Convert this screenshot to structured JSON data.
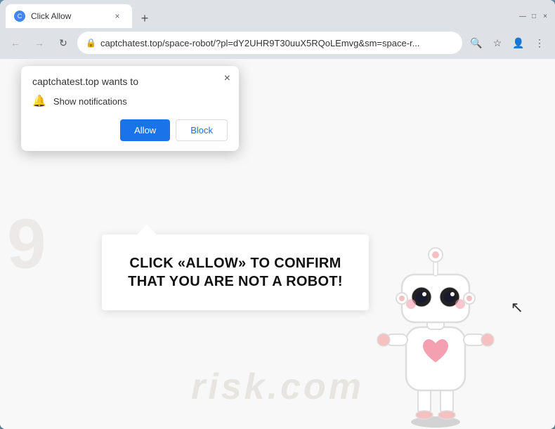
{
  "browser": {
    "tab_title": "Click Allow",
    "tab_favicon": "🔵",
    "address": "captchatest.top/space-robot/?pl=dY2UHR9T30uuX5RQoLEmvg&sm=space-r...",
    "new_tab_label": "+",
    "close_label": "×",
    "minimize_label": "—",
    "maximize_label": "□",
    "window_close_label": "×"
  },
  "nav": {
    "back_label": "←",
    "forward_label": "→",
    "refresh_label": "↻",
    "search_icon": "🔍",
    "star_icon": "☆",
    "profile_icon": "👤",
    "menu_icon": "⋮"
  },
  "popup": {
    "title": "captchatest.top wants to",
    "close_label": "×",
    "notification_text": "Show notifications",
    "allow_label": "Allow",
    "block_label": "Block"
  },
  "page": {
    "message": "CLICK «ALLOW» TO CONFIRM THAT YOU ARE NOT A ROBOT!",
    "watermark": "risk.com"
  },
  "colors": {
    "allow_btn": "#1a73e8",
    "block_btn_text": "#1a73e8",
    "browser_bg": "#dee1e6",
    "outer_border": "#6a9ab0"
  }
}
